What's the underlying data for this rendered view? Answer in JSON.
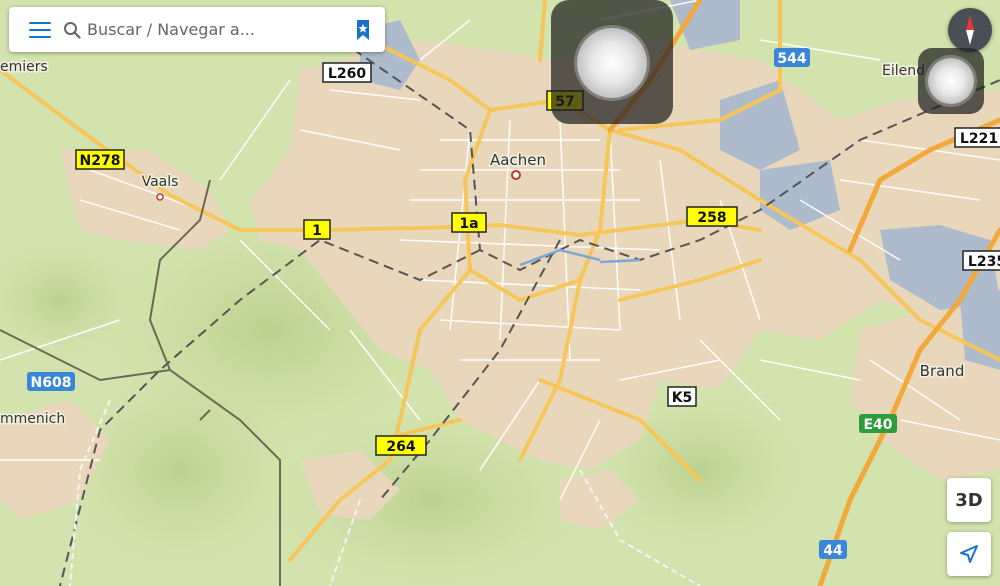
{
  "search": {
    "placeholder": "Buscar / Navegar a..."
  },
  "controls": {
    "mode_3d": "3D"
  },
  "places": [
    {
      "name": "Aachen"
    },
    {
      "name": "Vaals"
    },
    {
      "name": "Brand"
    },
    {
      "name": "Eilend"
    },
    {
      "name": "emiers"
    },
    {
      "name": "mmenich"
    }
  ],
  "road_shields": [
    {
      "ref": "L260",
      "style": "white"
    },
    {
      "ref": "57",
      "style": "yellow"
    },
    {
      "ref": "544",
      "style": "blue"
    },
    {
      "ref": "N278",
      "style": "yellow"
    },
    {
      "ref": "1",
      "style": "yellow"
    },
    {
      "ref": "1a",
      "style": "yellow"
    },
    {
      "ref": "258",
      "style": "yellow"
    },
    {
      "ref": "L221",
      "style": "white"
    },
    {
      "ref": "L235",
      "style": "white"
    },
    {
      "ref": "N608",
      "style": "blue"
    },
    {
      "ref": "K5",
      "style": "white"
    },
    {
      "ref": "E40",
      "style": "green"
    },
    {
      "ref": "264",
      "style": "yellow"
    },
    {
      "ref": "44",
      "style": "blue"
    }
  ],
  "colors": {
    "land": "#cfe0a8",
    "urban": "#e6d6bc",
    "water_industrial": "#aab7c9",
    "major_road": "#f6c65a",
    "motorway": "#f2a83a",
    "shield_yellow": "#ffff00",
    "shield_blue": "#3a86d8",
    "shield_green": "#2e9b3c",
    "accent": "#1a73c9"
  },
  "icons": [
    "menu-icon",
    "search-icon",
    "bookmark-icon",
    "compass-icon",
    "location-arrow-icon"
  ]
}
